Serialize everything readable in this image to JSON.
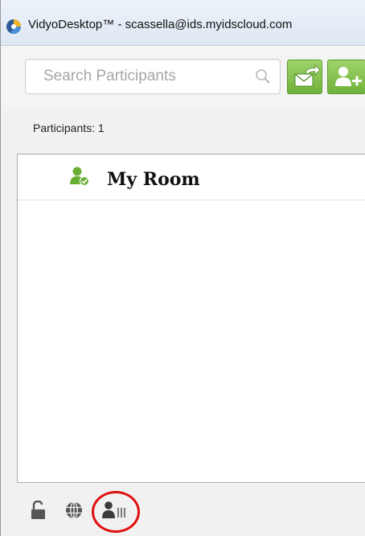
{
  "window": {
    "title": "VidyoDesktop™ - scassella@ids.myidscloud.com"
  },
  "search": {
    "placeholder": "Search Participants",
    "icon": "search-icon"
  },
  "toolbar": {
    "invite_email_icon": "envelope-arrow-icon",
    "add_participant_icon": "add-user-icon",
    "accent_color": "#7cbf45"
  },
  "participants": {
    "count_label": "Participants: 1",
    "rows": [
      {
        "name": "My Room",
        "icon": "user-check-icon"
      }
    ]
  },
  "bottom_bar": {
    "icons": [
      "lock-icon",
      "globe-icon",
      "participant-bars-icon"
    ],
    "highlight_color": "#e01010"
  }
}
